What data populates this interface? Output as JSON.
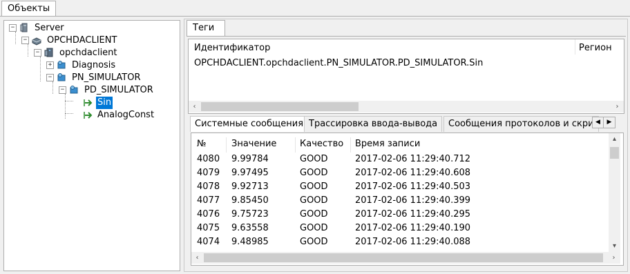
{
  "top_tab": "Объекты",
  "tree": {
    "items": [
      {
        "label": "Server"
      },
      {
        "label": "OPCHDACLIENT"
      },
      {
        "label": "opchdaclient"
      },
      {
        "label": "Diagnosis"
      },
      {
        "label": "PN_SIMULATOR"
      },
      {
        "label": "PD_SIMULATOR"
      },
      {
        "label": "Sin"
      },
      {
        "label": "AnalogConst"
      }
    ]
  },
  "tags_tab": "Теги",
  "tags_table": {
    "headers": [
      "Идентификатор",
      "Регион"
    ],
    "rows": [
      [
        "OPCHDACLIENT.opchdaclient.PN_SIMULATOR.PD_SIMULATOR.Sin",
        ""
      ]
    ]
  },
  "bottom_tabs": [
    "Системные сообщения",
    "Трассировка ввода-вывода",
    "Сообщения протоколов и скри"
  ],
  "log_table": {
    "headers": [
      "№",
      "Значение",
      "Качество",
      "Время записи"
    ],
    "rows": [
      [
        "4080",
        "9.99784",
        "GOOD",
        "2017-02-06 11:29:40.712"
      ],
      [
        "4079",
        "9.97495",
        "GOOD",
        "2017-02-06 11:29:40.608"
      ],
      [
        "4078",
        "9.92713",
        "GOOD",
        "2017-02-06 11:29:40.503"
      ],
      [
        "4077",
        "9.85450",
        "GOOD",
        "2017-02-06 11:29:40.399"
      ],
      [
        "4076",
        "9.75723",
        "GOOD",
        "2017-02-06 11:29:40.295"
      ],
      [
        "4075",
        "9.63558",
        "GOOD",
        "2017-02-06 11:29:40.190"
      ],
      [
        "4074",
        "9.48985",
        "GOOD",
        "2017-02-06 11:29:40.088"
      ]
    ]
  },
  "colors": {
    "selection": "#0078d7",
    "tag_arrow": "#2e8b2e"
  }
}
